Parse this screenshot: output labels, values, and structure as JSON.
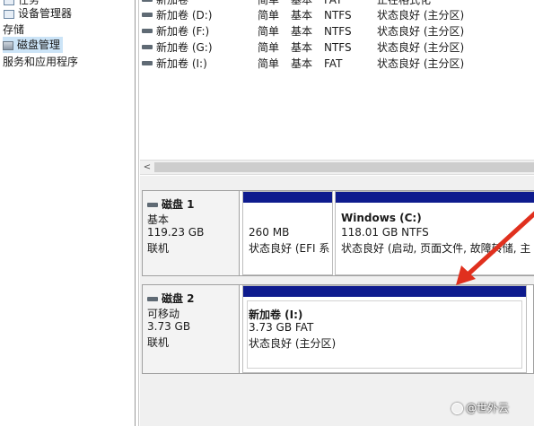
{
  "nav": {
    "items": [
      {
        "label": "任务"
      },
      {
        "label": "设备管理器"
      },
      {
        "label": "存储"
      },
      {
        "label": "磁盘管理"
      },
      {
        "label": "服务和应用程序"
      }
    ]
  },
  "volumes": [
    {
      "name": "新加卷",
      "layout": "简单",
      "type": "基本",
      "fs": "FAT",
      "status": "正在格式化"
    },
    {
      "name": "新加卷 (D:)",
      "layout": "简单",
      "type": "基本",
      "fs": "NTFS",
      "status": "状态良好 (主分区)"
    },
    {
      "name": "新加卷 (F:)",
      "layout": "简单",
      "type": "基本",
      "fs": "NTFS",
      "status": "状态良好 (主分区)"
    },
    {
      "name": "新加卷 (G:)",
      "layout": "简单",
      "type": "基本",
      "fs": "NTFS",
      "status": "状态良好 (主分区)"
    },
    {
      "name": "新加卷 (I:)",
      "layout": "简单",
      "type": "基本",
      "fs": "FAT",
      "status": "状态良好 (主分区)"
    }
  ],
  "scrollbar": {
    "left_arrow": "<"
  },
  "disks": [
    {
      "title": "磁盘 1",
      "kind": "基本",
      "size": "119.23 GB",
      "state": "联机",
      "partitions": [
        {
          "name": "",
          "size": "260 MB",
          "status": "状态良好 (EFI 系"
        },
        {
          "name": "Windows  (C:)",
          "size": "118.01 GB NTFS",
          "status": "状态良好 (启动, 页面文件, 故障转储, 主"
        }
      ]
    },
    {
      "title": "磁盘 2",
      "kind": "可移动",
      "size": "3.73 GB",
      "state": "联机",
      "partitions": [
        {
          "name": "新加卷  (I:)",
          "size": "3.73 GB FAT",
          "status": "状态良好 (主分区)"
        }
      ]
    }
  ],
  "annotation": {
    "arrow_color": "#e0301e"
  },
  "watermark": {
    "text": "@世外云"
  },
  "colors": {
    "partition_bar": "#0e1b8e",
    "selected_nav": "#cce4f7"
  }
}
